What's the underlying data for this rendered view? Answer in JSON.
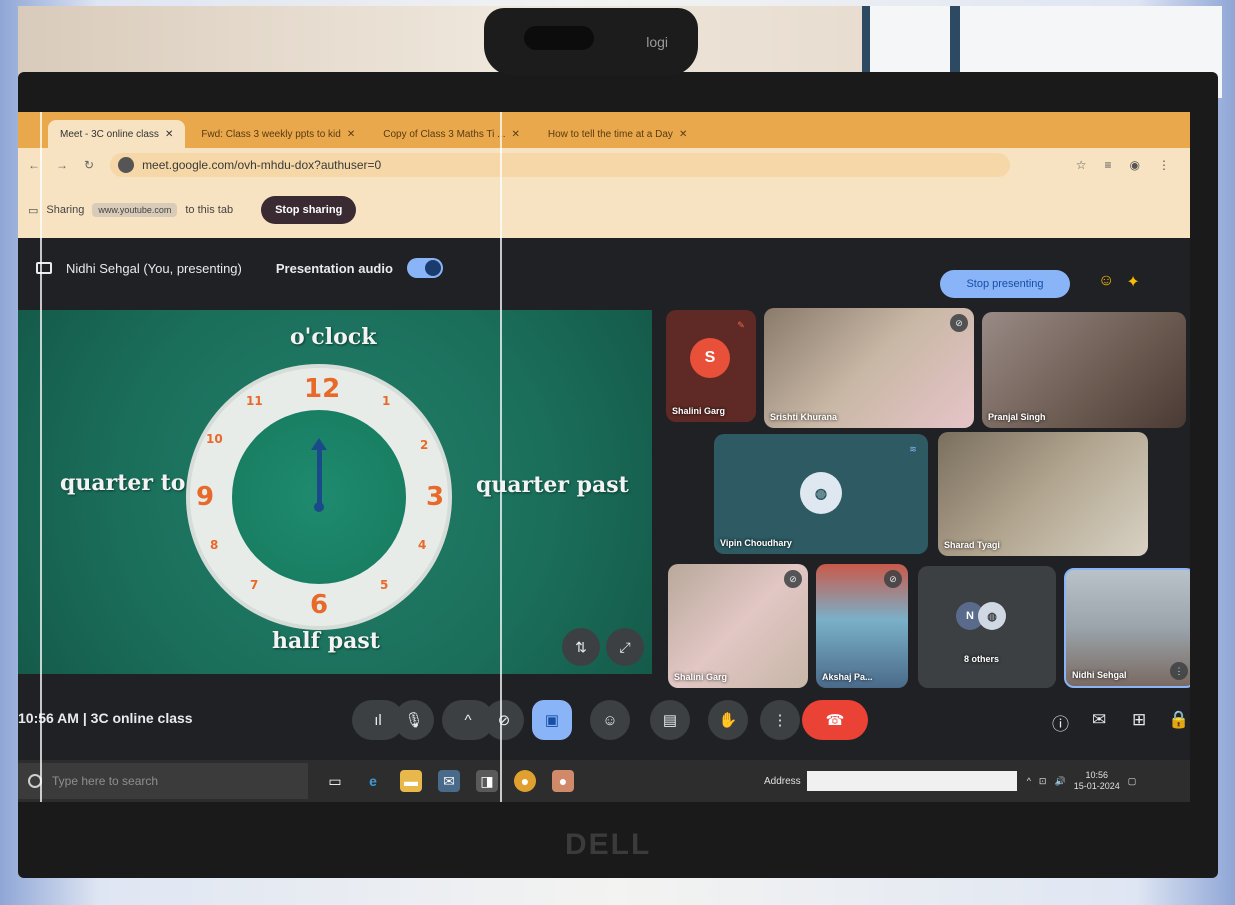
{
  "webcam": {
    "brand": "logi"
  },
  "monitor": {
    "brand": "DELL"
  },
  "browser": {
    "tabs": [
      {
        "label": "Meet - 3C online class",
        "active": true
      },
      {
        "label": "Fwd: Class 3 weekly ppts to kid",
        "active": false
      },
      {
        "label": "Copy of Class 3 Maths Ti ...",
        "active": false
      },
      {
        "label": "How to tell the time at a Day",
        "active": false
      }
    ],
    "url": "meet.google.com/ovh-mhdu-dox?authuser=0",
    "share_bar": {
      "prefix": "Sharing",
      "site": "www.youtube.com",
      "suffix": "to this tab",
      "stop_label": "Stop sharing"
    }
  },
  "meet": {
    "presenter_label": "Nidhi Sehgal (You, presenting)",
    "presentation_audio_label": "Presentation audio",
    "stop_presenting_label": "Stop presenting",
    "slide": {
      "top_label": "o'clock",
      "left_label": "quarter to",
      "right_label": "quarter past",
      "bottom_label": "half past",
      "numbers": [
        "12",
        "1",
        "2",
        "3",
        "4",
        "5",
        "6",
        "7",
        "8",
        "9",
        "10",
        "11"
      ]
    },
    "participants": [
      {
        "name": "Shalini Garg",
        "initial": "S"
      },
      {
        "name": "Srishti Khurana"
      },
      {
        "name": "Pranjal Singh"
      },
      {
        "name": "Vipin Choudhary"
      },
      {
        "name": "Sharad Tyagi"
      },
      {
        "name": "Shalini Garg"
      },
      {
        "name": "Akshaj Pa..."
      },
      {
        "name": "8 others"
      },
      {
        "name": "Nidhi Sehgal"
      }
    ],
    "others_count": "8 others",
    "time": "10:56 AM",
    "meeting_name": "3C online class"
  },
  "taskbar": {
    "search_placeholder": "Type here to search",
    "address_label": "Address",
    "clock_time": "10:56",
    "clock_date": "15-01-2024"
  },
  "colors": {
    "tab_bar": "#e9a84c",
    "slide_bg": "#1a6e5a",
    "clock_numbers": "#e86a2a",
    "end_call": "#ea4335",
    "meet_accent": "#8ab4f8"
  }
}
